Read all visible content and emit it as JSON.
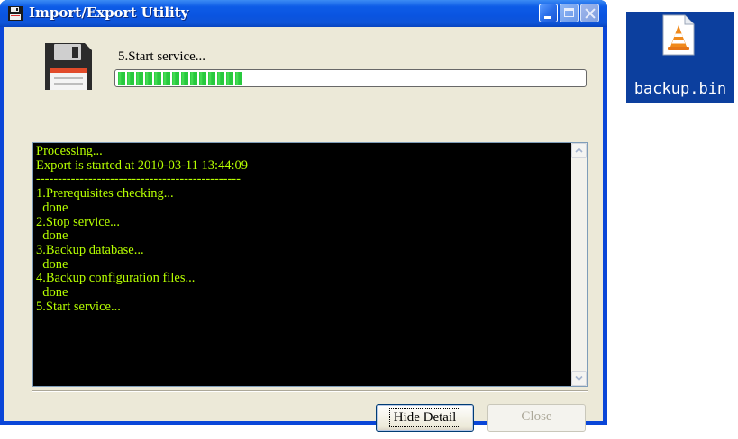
{
  "window": {
    "title": "Import/Export Utility",
    "title_icon": "floppy-disk-icon"
  },
  "status": {
    "step_text": "5.Start service...",
    "progress_fraction": 0.27
  },
  "console": {
    "lines": [
      "Processing...",
      "Export is started at 2010-03-11 13:44:09",
      "-----------------------------------------------",
      "1.Prerequisites checking...",
      "  done",
      "2.Stop service...",
      "  done",
      "3.Backup database...",
      "  done",
      "4.Backup configuration files...",
      "  done",
      "5.Start service..."
    ],
    "text_color": "#b6ff00",
    "background": "#000000"
  },
  "buttons": {
    "hide_detail": "Hide Detail",
    "close": "Close"
  },
  "desktop": {
    "file_label": "backup.bin",
    "file_icon": "vlc-cone-icon"
  }
}
